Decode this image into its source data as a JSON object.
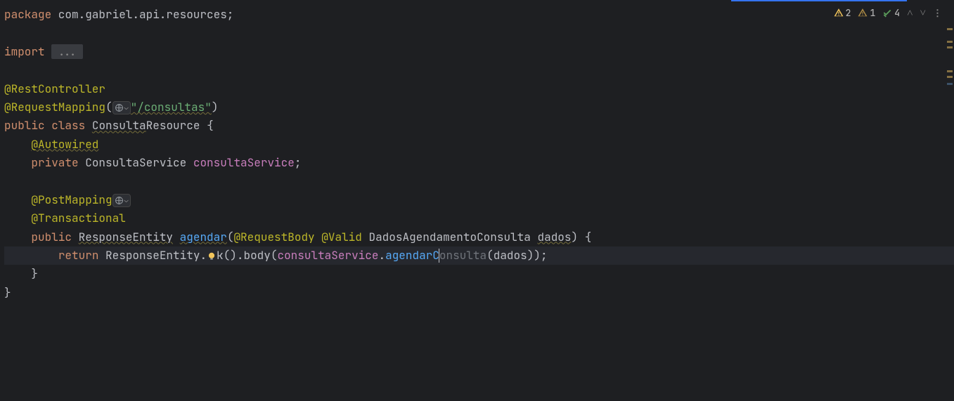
{
  "indicators": {
    "warn_yellow": "2",
    "warn_amber": "1",
    "check_green": "4"
  },
  "code": {
    "package_kw": "package",
    "package_name": " com.gabriel.api.resources;",
    "import_kw": "import",
    "fold": "...",
    "anno_restcontroller": "@RestController",
    "anno_requestmapping": "@RequestMapping",
    "mapping_path": "\"/consultas\"",
    "public_kw": "public",
    "class_kw": "class",
    "class_name_1": "Consulta",
    "class_name_2": "Resource",
    "anno_autowired": "@Autowired",
    "private_kw": "private",
    "type_consultaservice": "ConsultaService",
    "field_consultaservice": "consultaService",
    "anno_postmapping": "@PostMapping",
    "anno_transactional": "@Transactional",
    "type_responseentity": "ResponseEntity",
    "method_agendar": "agendar",
    "anno_requestbody": "@RequestBody",
    "anno_valid": "@Valid",
    "type_dados": "DadosAgendamentoConsulta",
    "param_dados": "dados",
    "return_kw": "return",
    "response_entity": "ResponseEntity",
    "ok_method": "k()",
    "body_method": "body",
    "service_field": "consultaService",
    "call_method_pre": "agendarC",
    "call_method_hint": "onsulta",
    "call_arg": "dados",
    "punct_oparen": "(",
    "punct_cparen": ")",
    "punct_obrace": "{",
    "punct_cbrace": "}",
    "punct_semi": ";",
    "punct_dot": "."
  }
}
